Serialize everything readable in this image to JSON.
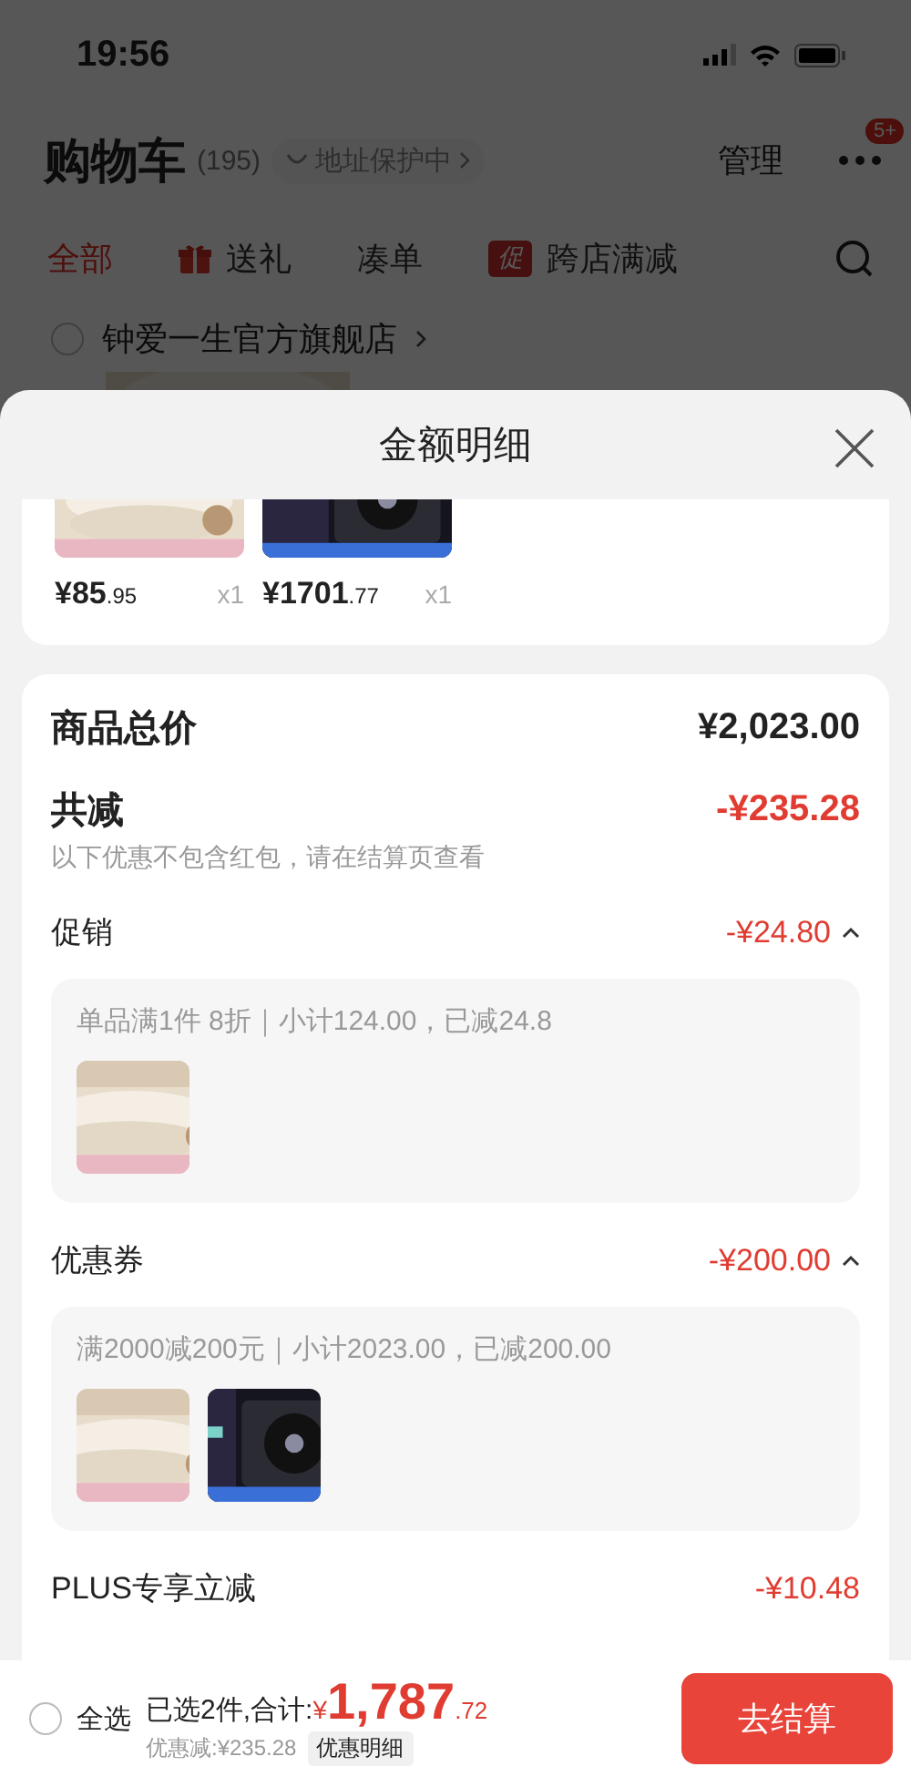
{
  "status_bar": {
    "time": "19:56"
  },
  "header": {
    "title": "购物车",
    "count": "(195)",
    "address": "地址保护中",
    "manage": "管理",
    "more_badge": "5+"
  },
  "tabs": [
    {
      "label": "全部",
      "selected": true,
      "kind": "plain"
    },
    {
      "label": "送礼",
      "selected": false,
      "kind": "gift"
    },
    {
      "label": "凑单",
      "selected": false,
      "kind": "plain"
    },
    {
      "label": "跨店满减",
      "selected": false,
      "kind": "promo",
      "icon_text": "促"
    }
  ],
  "store": {
    "name": "钟爱一生官方旗舰店",
    "checked": false
  },
  "sheet": {
    "title": "金额明细",
    "items": [
      {
        "kind": "picture",
        "price": "¥85",
        "cents": ".95",
        "qty": "x1"
      },
      {
        "kind": "picture",
        "price": "¥1701",
        "cents": ".77",
        "qty": "x1"
      }
    ],
    "total": {
      "label": "商品总价",
      "value": "¥2,023.00"
    },
    "discount": {
      "label": "共减",
      "value": "-¥235.28",
      "note": "以下优惠不包含红包，请在结算页查看"
    },
    "sections": [
      {
        "kind": "group",
        "label": "促销",
        "value": "-¥24.80",
        "expanded": true,
        "detail": "单品满1件 8折｜小计124.00，已减24.8"
      },
      {
        "kind": "group",
        "label": "优惠券",
        "value": "-¥200.00",
        "expanded": true,
        "detail": "满2000减200元｜小计2023.00，已减200.00"
      },
      {
        "kind": "line",
        "label": "PLUS专享立减",
        "value": "-¥10.48"
      }
    ]
  },
  "footer": {
    "select_all": "全选",
    "checked": false,
    "selected_text": "已选2件,合计:",
    "currency": "¥",
    "amount": "1,787",
    "cents": ".72",
    "saved": "优惠减:¥235.28",
    "detail_button": "优惠明细",
    "checkout": "去结算"
  }
}
